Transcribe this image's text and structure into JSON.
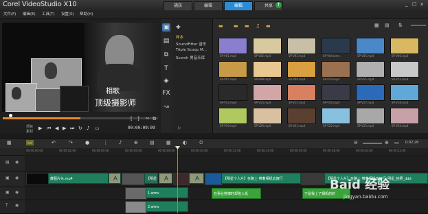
{
  "app": {
    "title": "Corel VideoStudio X10"
  },
  "tabs": [
    {
      "label": "捕获",
      "active": false
    },
    {
      "label": "编辑",
      "active": false
    },
    {
      "label": "编辑",
      "active": true
    },
    {
      "label": "共享",
      "active": false
    }
  ],
  "window_controls": [
    "_",
    "□",
    "x"
  ],
  "menu": [
    "文件(F)",
    "编辑(E)",
    "工具(T)",
    "设置(S)",
    "帮助(H)"
  ],
  "player": {
    "overlay_line1": "相歌",
    "overlay_line2": "顶级摄影师",
    "mode_labels": [
      "项目",
      "素材"
    ],
    "timecode": "00:00:09:09",
    "progress": 0.5
  },
  "library": {
    "nav_items": [
      "样本",
      "SoundFitter 音乐",
      "Triple Scoop M...",
      "Scorch 男音乐库"
    ],
    "selected_nav": "样本",
    "thumbnails": [
      {
        "caption": "SP-V01.mp4",
        "color": "#8a7fcf"
      },
      {
        "caption": "SP-V02.mp4",
        "color": "#d9c9a0"
      },
      {
        "caption": "SP-V03.mp4",
        "color": "#c8c0a6"
      },
      {
        "caption": "SP-V04.wmv",
        "color": "#2a3a4a"
      },
      {
        "caption": "SP-V05.mp4",
        "color": "#4a88c8"
      },
      {
        "caption": "SP-V06.mp4",
        "color": "#d8b860"
      },
      {
        "caption": "SP-V07.mp4",
        "color": "#c89a48"
      },
      {
        "caption": "SP-V08.mp4",
        "color": "#e8c890"
      },
      {
        "caption": "SP-V09.mp4",
        "color": "#d8a040"
      },
      {
        "caption": "SP-V10.mp4",
        "color": "#9a7050"
      },
      {
        "caption": "SP-V11.mp4",
        "color": "#b0b0b0"
      },
      {
        "caption": "SP-V12.mp4",
        "color": "#c8c8c8"
      },
      {
        "caption": "SP-V13.mp4",
        "color": "#2a2a2a"
      },
      {
        "caption": "SP-V14.mp4",
        "color": "#d2a6a6"
      },
      {
        "caption": "SP-V15.mp4",
        "color": "#d88060"
      },
      {
        "caption": "SP-V16.mp4",
        "color": "#3a3a48"
      },
      {
        "caption": "SP-V17.mp4",
        "color": "#2a6ab8"
      },
      {
        "caption": "SP-V18.mp4",
        "color": "#60a8d8"
      },
      {
        "caption": "SP-V19.mp4",
        "color": "#b0c860"
      },
      {
        "caption": "SP-V20.mp4",
        "color": "#d8c0a0"
      },
      {
        "caption": "SP-V21.mp4",
        "color": "#5a4030"
      },
      {
        "caption": "SP-V22.mp4",
        "color": "#88c0e0"
      },
      {
        "caption": "SP-V23.mp4",
        "color": "#a8a8a8"
      },
      {
        "caption": "SP-V24.mp4",
        "color": "#c8a0a8"
      }
    ]
  },
  "timeline": {
    "ruler_ticks": [
      "00:00:00:00",
      "00:00:02:00",
      "00:00:04:00",
      "00:00:06:00",
      "00:00:08:00",
      "00:00:10:00",
      "00:00:12:00",
      "00:00:14:00",
      "00:00:16:00",
      "00:00:18:00",
      "00:00:20:00",
      "00:00:22:00"
    ],
    "clips": {
      "video_1": "教程片头.mp4",
      "video_2": "【明星个人片】",
      "video_3": "【明星个人片】在路上·带着相机去旅行",
      "video_4": "【明星个人片】在路上·带着相机去旅行_明星_拍照_ddd",
      "overlay_1": "1.wmv",
      "overlay_2": "2.wmv",
      "title_1": "在事业拼搏时却陷入低",
      "title_2": "于是我上了相机的的"
    },
    "watermark_main": "Baid 经验",
    "watermark_url": "jingyan.baidu.com"
  }
}
